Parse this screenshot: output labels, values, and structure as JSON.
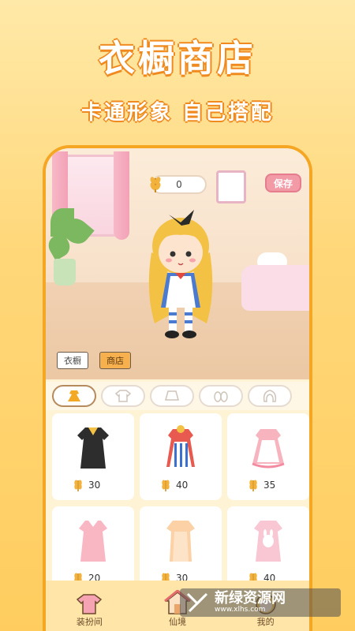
{
  "promo": {
    "title": "衣橱商店",
    "subtitle": "卡通形象 自己搭配"
  },
  "header": {
    "coins": "0",
    "save_label": "保存"
  },
  "room_tabs": [
    {
      "label": "衣橱"
    },
    {
      "label": "商店"
    }
  ],
  "categories": [
    {
      "icon": "dress-icon",
      "active": true
    },
    {
      "icon": "shirt-icon",
      "active": false
    },
    {
      "icon": "skirt-icon",
      "active": false
    },
    {
      "icon": "shoes-icon",
      "active": false
    },
    {
      "icon": "hair-icon",
      "active": false
    }
  ],
  "items": [
    {
      "price": "30",
      "color": "#2d2d2d"
    },
    {
      "price": "40",
      "color": "#e85a4f"
    },
    {
      "price": "35",
      "color": "#f7b4be"
    },
    {
      "price": "20",
      "color": "#f9b7c4"
    },
    {
      "price": "30",
      "color": "#fbd1a5"
    },
    {
      "price": "40",
      "color": "#f8c7d3"
    }
  ],
  "bottom_nav": [
    {
      "label": "装扮间",
      "icon": "shirt-icon"
    },
    {
      "label": "仙境",
      "icon": "house-icon"
    },
    {
      "label": "我的",
      "icon": "profile-icon"
    }
  ],
  "watermark": {
    "text": "新绿资源网",
    "url": "www.xlhs.com"
  },
  "colors": {
    "accent": "#f5a623",
    "save": "#f29aa6",
    "shop_tab": "#f6b04e"
  }
}
